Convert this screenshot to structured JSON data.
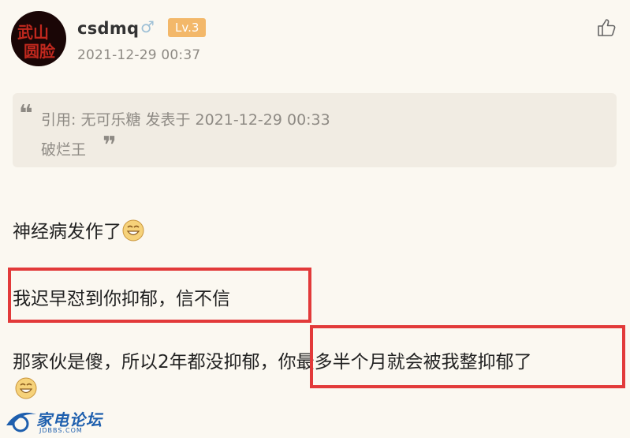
{
  "post": {
    "username": "csdmq",
    "gender_symbol": "♂",
    "level": "Lv.3",
    "timestamp": "2021-12-29 00:37",
    "avatar_text": "武山",
    "avatar_text2": "圆脸"
  },
  "quote": {
    "open_mark": "❝",
    "line1": "引用: 无可乐糖 发表于 2021-12-29 00:33",
    "line2": "破烂王",
    "close_mark": "❞"
  },
  "messages": {
    "line1": "神经病发作了",
    "line2": "我迟早怼到你抑郁，信不信",
    "line3_a": "那家伙是傻，所以2年都没抑郁，",
    "line3_b": "你最多半个月就会被我整抑郁了"
  },
  "watermark": {
    "text": "家电论坛",
    "sub": "JDBBS.COM"
  },
  "icons": {
    "like": "thumbs-up-icon",
    "emoji": "grin-emoji-icon"
  },
  "colors": {
    "background": "#fbf8f1",
    "level_badge": "#f3b86a",
    "highlight": "#e23a3a",
    "muted_text": "#8e8a84"
  }
}
